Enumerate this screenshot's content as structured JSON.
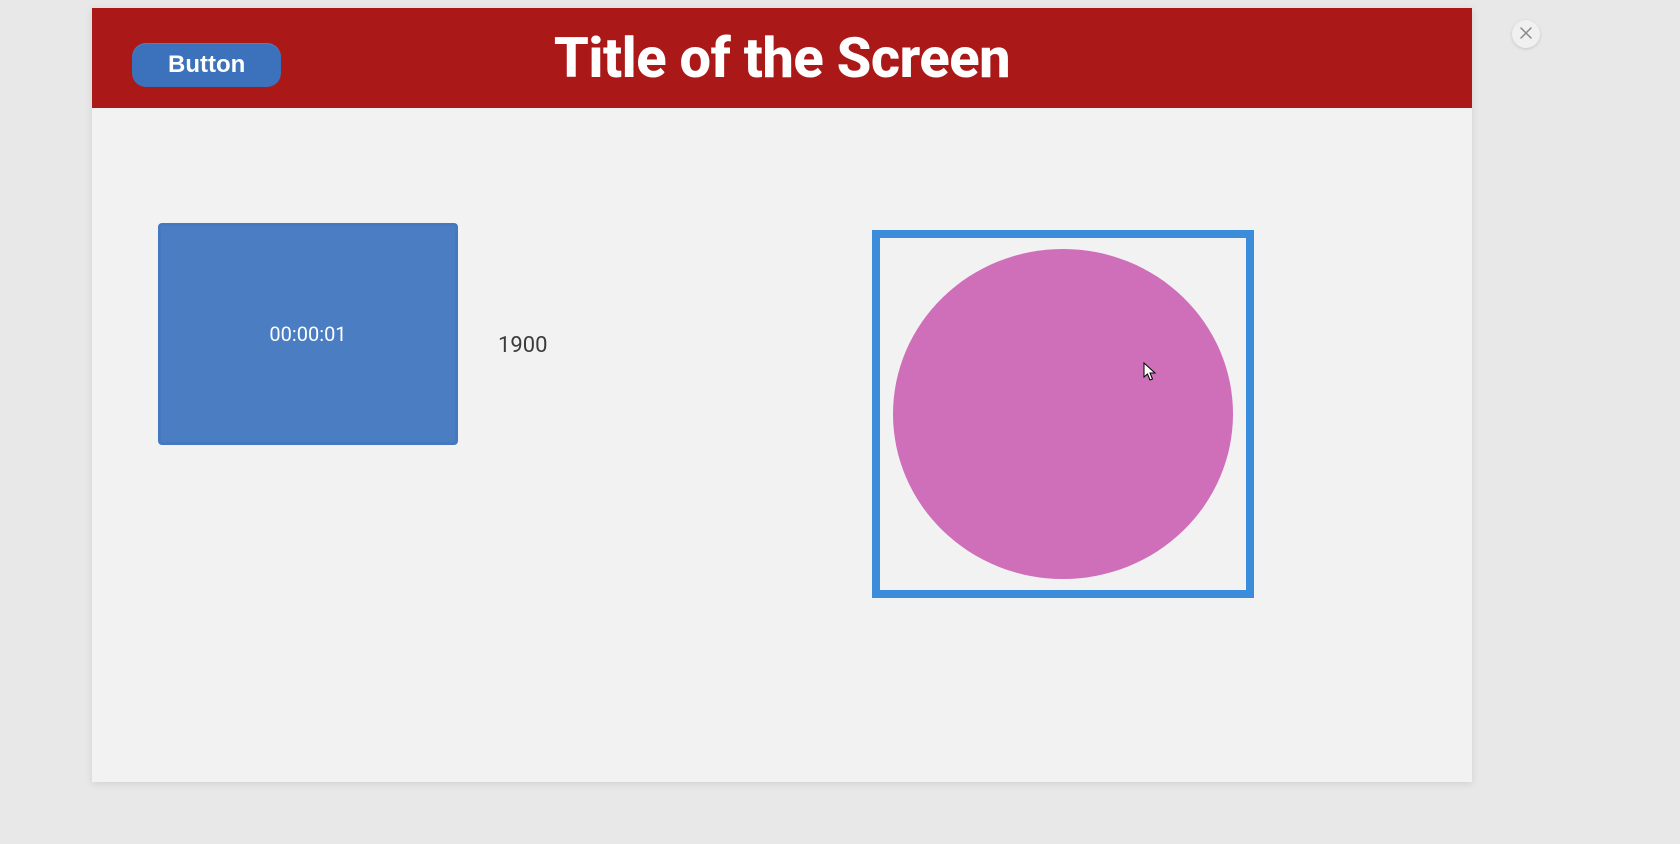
{
  "header": {
    "button_label": "Button",
    "title": "Title of the Screen"
  },
  "content": {
    "timer_value": "00:00:01",
    "year_value": "1900"
  },
  "colors": {
    "header_bg": "#ab1818",
    "button_blue": "#3c72bb",
    "tile_blue": "#4b7dc3",
    "frame_blue": "#3c8cdc",
    "circle_pink": "#cf6eb9"
  }
}
